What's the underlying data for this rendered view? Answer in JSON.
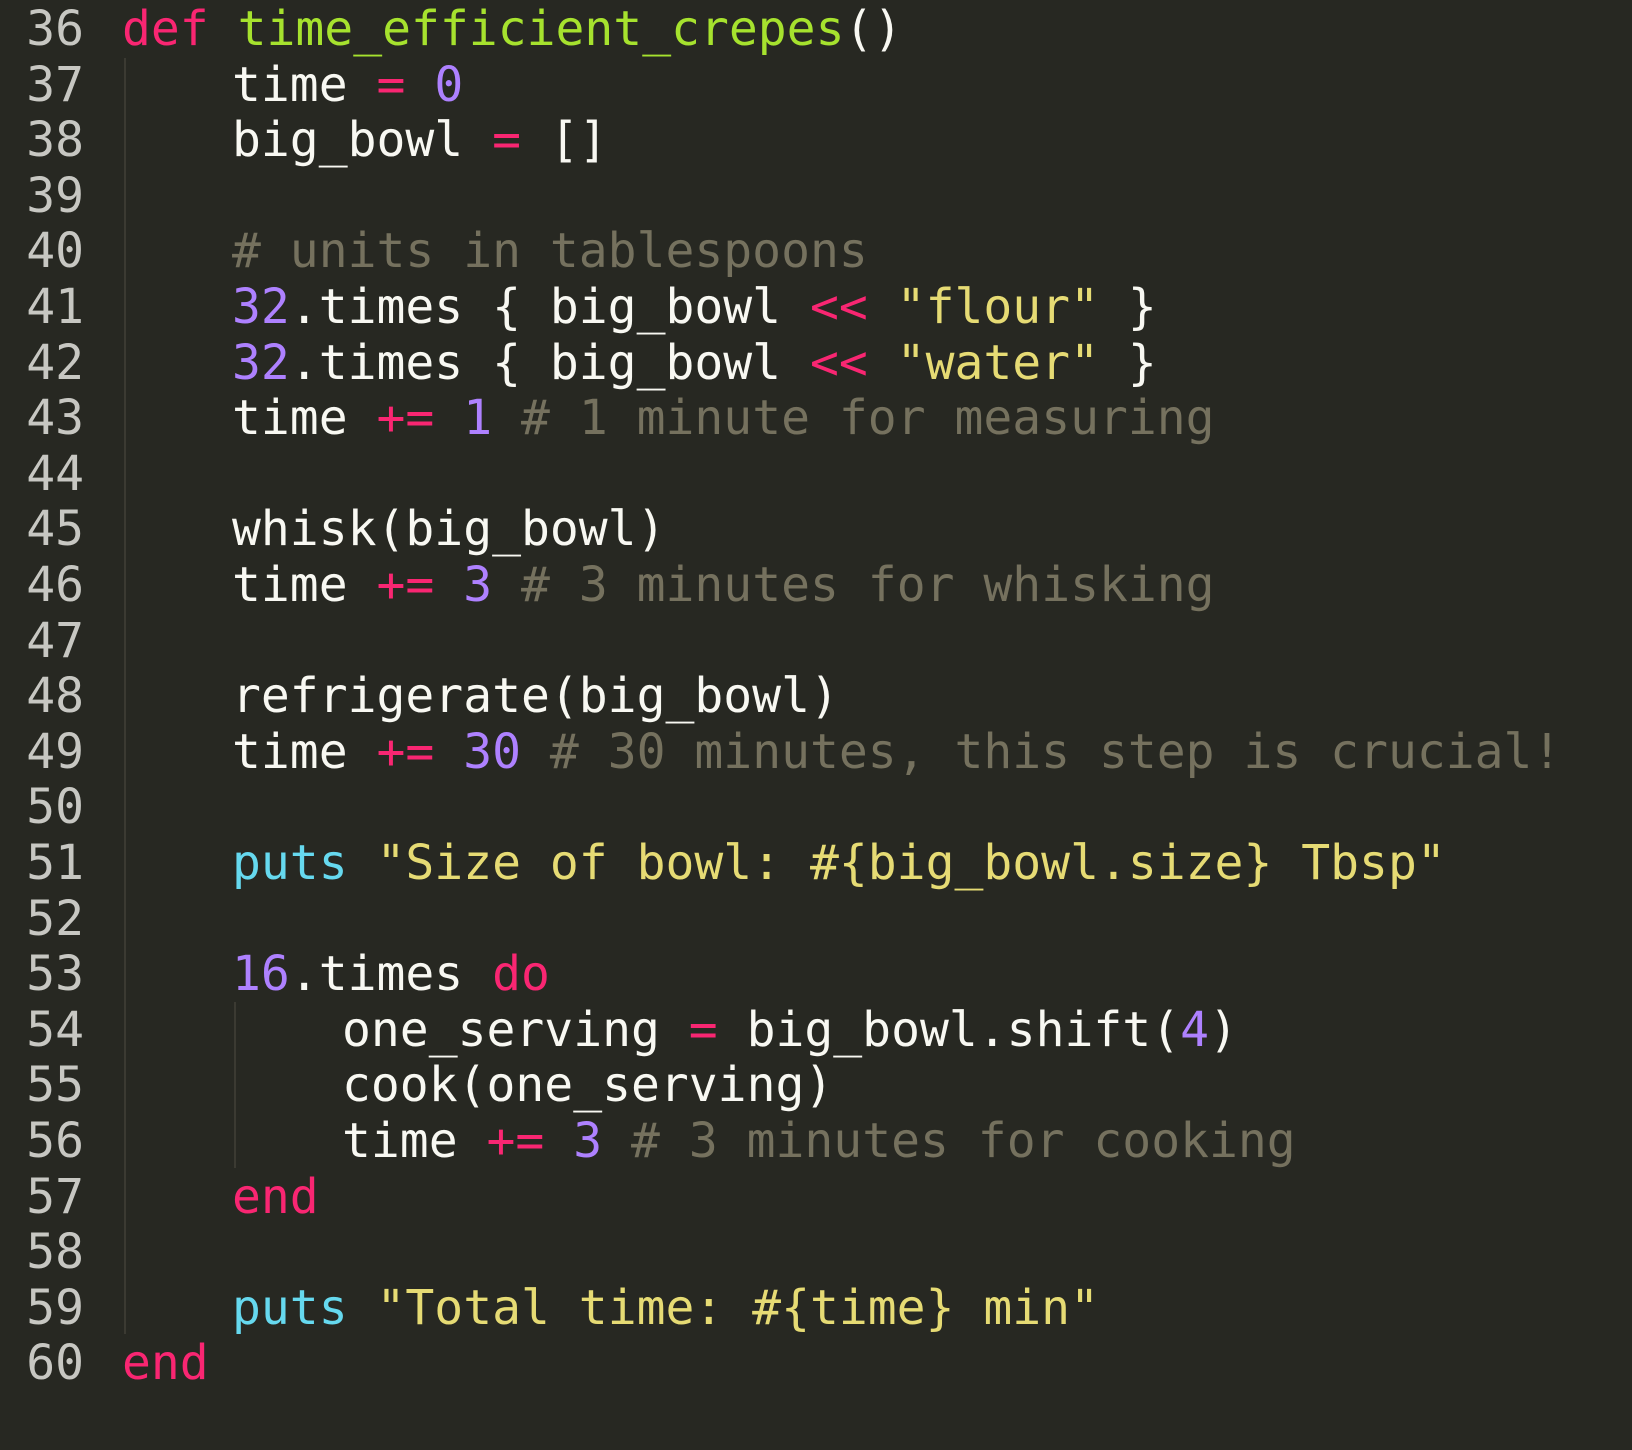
{
  "editor": {
    "theme_colors": {
      "background": "#272822",
      "gutter_text": "#c7c7c2",
      "plain": "#f8f8f2",
      "keyword": "#f92672",
      "function_name": "#a6e22e",
      "number": "#ae81ff",
      "string": "#e6db74",
      "comment": "#75715e",
      "builtin": "#66d9ef"
    },
    "lines": [
      {
        "number": "36",
        "indent": 0,
        "tokens": [
          {
            "t": "def",
            "c": "kw"
          },
          {
            "t": " ",
            "c": "plain"
          },
          {
            "t": "time_efficient_crepes",
            "c": "fn"
          },
          {
            "t": "()",
            "c": "plain"
          }
        ]
      },
      {
        "number": "37",
        "indent": 1,
        "tokens": [
          {
            "t": "time ",
            "c": "plain"
          },
          {
            "t": "=",
            "c": "op"
          },
          {
            "t": " ",
            "c": "plain"
          },
          {
            "t": "0",
            "c": "num"
          }
        ]
      },
      {
        "number": "38",
        "indent": 1,
        "tokens": [
          {
            "t": "big_bowl ",
            "c": "plain"
          },
          {
            "t": "=",
            "c": "op"
          },
          {
            "t": " []",
            "c": "plain"
          }
        ]
      },
      {
        "number": "39",
        "indent": 1,
        "tokens": []
      },
      {
        "number": "40",
        "indent": 1,
        "tokens": [
          {
            "t": "# units in tablespoons",
            "c": "cmt"
          }
        ]
      },
      {
        "number": "41",
        "indent": 1,
        "tokens": [
          {
            "t": "32",
            "c": "num"
          },
          {
            "t": ".times { big_bowl ",
            "c": "plain"
          },
          {
            "t": "<<",
            "c": "op"
          },
          {
            "t": " ",
            "c": "plain"
          },
          {
            "t": "\"flour\"",
            "c": "str"
          },
          {
            "t": " }",
            "c": "plain"
          }
        ]
      },
      {
        "number": "42",
        "indent": 1,
        "tokens": [
          {
            "t": "32",
            "c": "num"
          },
          {
            "t": ".times { big_bowl ",
            "c": "plain"
          },
          {
            "t": "<<",
            "c": "op"
          },
          {
            "t": " ",
            "c": "plain"
          },
          {
            "t": "\"water\"",
            "c": "str"
          },
          {
            "t": " }",
            "c": "plain"
          }
        ]
      },
      {
        "number": "43",
        "indent": 1,
        "tokens": [
          {
            "t": "time ",
            "c": "plain"
          },
          {
            "t": "+=",
            "c": "op"
          },
          {
            "t": " ",
            "c": "plain"
          },
          {
            "t": "1",
            "c": "num"
          },
          {
            "t": " ",
            "c": "plain"
          },
          {
            "t": "# 1 minute for measuring",
            "c": "cmt"
          }
        ]
      },
      {
        "number": "44",
        "indent": 1,
        "tokens": []
      },
      {
        "number": "45",
        "indent": 1,
        "tokens": [
          {
            "t": "whisk(big_bowl)",
            "c": "plain"
          }
        ]
      },
      {
        "number": "46",
        "indent": 1,
        "tokens": [
          {
            "t": "time ",
            "c": "plain"
          },
          {
            "t": "+=",
            "c": "op"
          },
          {
            "t": " ",
            "c": "plain"
          },
          {
            "t": "3",
            "c": "num"
          },
          {
            "t": " ",
            "c": "plain"
          },
          {
            "t": "# 3 minutes for whisking",
            "c": "cmt"
          }
        ]
      },
      {
        "number": "47",
        "indent": 1,
        "tokens": []
      },
      {
        "number": "48",
        "indent": 1,
        "tokens": [
          {
            "t": "refrigerate(big_bowl)",
            "c": "plain"
          }
        ]
      },
      {
        "number": "49",
        "indent": 1,
        "tokens": [
          {
            "t": "time ",
            "c": "plain"
          },
          {
            "t": "+=",
            "c": "op"
          },
          {
            "t": " ",
            "c": "plain"
          },
          {
            "t": "30",
            "c": "num"
          },
          {
            "t": " ",
            "c": "plain"
          },
          {
            "t": "# 30 minutes, this step is crucial!",
            "c": "cmt"
          }
        ]
      },
      {
        "number": "50",
        "indent": 1,
        "tokens": []
      },
      {
        "number": "51",
        "indent": 1,
        "tokens": [
          {
            "t": "puts",
            "c": "call"
          },
          {
            "t": " ",
            "c": "plain"
          },
          {
            "t": "\"Size of bowl: #{big_bowl.size} Tbsp\"",
            "c": "str"
          }
        ]
      },
      {
        "number": "52",
        "indent": 1,
        "tokens": []
      },
      {
        "number": "53",
        "indent": 1,
        "tokens": [
          {
            "t": "16",
            "c": "num"
          },
          {
            "t": ".times ",
            "c": "plain"
          },
          {
            "t": "do",
            "c": "kw"
          }
        ]
      },
      {
        "number": "54",
        "indent": 2,
        "tokens": [
          {
            "t": "one_serving ",
            "c": "plain"
          },
          {
            "t": "=",
            "c": "op"
          },
          {
            "t": " big_bowl.shift(",
            "c": "plain"
          },
          {
            "t": "4",
            "c": "num"
          },
          {
            "t": ")",
            "c": "plain"
          }
        ]
      },
      {
        "number": "55",
        "indent": 2,
        "tokens": [
          {
            "t": "cook(one_serving)",
            "c": "plain"
          }
        ]
      },
      {
        "number": "56",
        "indent": 2,
        "tokens": [
          {
            "t": "time ",
            "c": "plain"
          },
          {
            "t": "+=",
            "c": "op"
          },
          {
            "t": " ",
            "c": "plain"
          },
          {
            "t": "3",
            "c": "num"
          },
          {
            "t": " ",
            "c": "plain"
          },
          {
            "t": "# 3 minutes for cooking",
            "c": "cmt"
          }
        ]
      },
      {
        "number": "57",
        "indent": 1,
        "tokens": [
          {
            "t": "end",
            "c": "kw"
          }
        ]
      },
      {
        "number": "58",
        "indent": 1,
        "tokens": []
      },
      {
        "number": "59",
        "indent": 1,
        "tokens": [
          {
            "t": "puts",
            "c": "call"
          },
          {
            "t": " ",
            "c": "plain"
          },
          {
            "t": "\"Total time: #{time} min\"",
            "c": "str"
          }
        ]
      },
      {
        "number": "60",
        "indent": 0,
        "tokens": [
          {
            "t": "end",
            "c": "kw"
          }
        ]
      }
    ]
  }
}
